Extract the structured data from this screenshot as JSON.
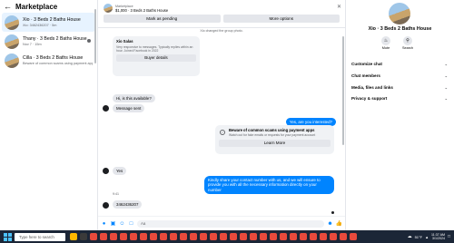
{
  "sidebar": {
    "title": "Marketplace",
    "conversations": [
      {
        "name": "Xio · 3 Beds 2 Baths House",
        "sub": "Xio: 3462436207 · 5m"
      },
      {
        "name": "Thany · 3 Beds 2 Baths House",
        "sub": "Nov 7 · 15m"
      },
      {
        "name": "Cilla · 3 Beds 2 Baths House",
        "sub": "Beware of common scams using payment apps"
      }
    ]
  },
  "chat": {
    "header": {
      "label": "Marketplace",
      "listing": "$1,000 · 3 Beds 2 Baths House",
      "mark_pending": "Mark as pending",
      "more_options": "More options"
    },
    "system_note": "Xio changed the group photo.",
    "buyer_card": {
      "name": "Xio Salas",
      "sub": "Very responsive to messages. Typically replies within an hour. Joined Facebook in 2022",
      "button": "Buyer details"
    },
    "messages": [
      {
        "text": "Hi, is this available?"
      },
      {
        "text": "Message sent"
      },
      {
        "text": "Yes, are you interested?"
      },
      {
        "text": "Yes"
      },
      {
        "text": "Kindly share your contact number with us, and we will ensure to provide you with all the necessary information directly on your number"
      },
      {
        "text": "3462436207"
      }
    ],
    "warning_card": {
      "title": "Beware of common scams using payment apps",
      "sub": "Watch out for fake emails or requests for your payment account",
      "button": "Learn More"
    },
    "timestamps": [
      "9:41",
      "10:15"
    ],
    "composer_placeholder": "Aa"
  },
  "right_panel": {
    "title": "Xio · 3 Beds 2 Baths House",
    "actions": [
      {
        "label": "Mute"
      },
      {
        "label": "Search"
      }
    ],
    "sections": [
      "Customize chat",
      "Chat members",
      "Media, files and links",
      "Privacy & support"
    ]
  },
  "taskbar": {
    "search_placeholder": "Type here to search",
    "temperature": "51°F",
    "time": "11:37 AM",
    "date": "3/1/2024"
  }
}
